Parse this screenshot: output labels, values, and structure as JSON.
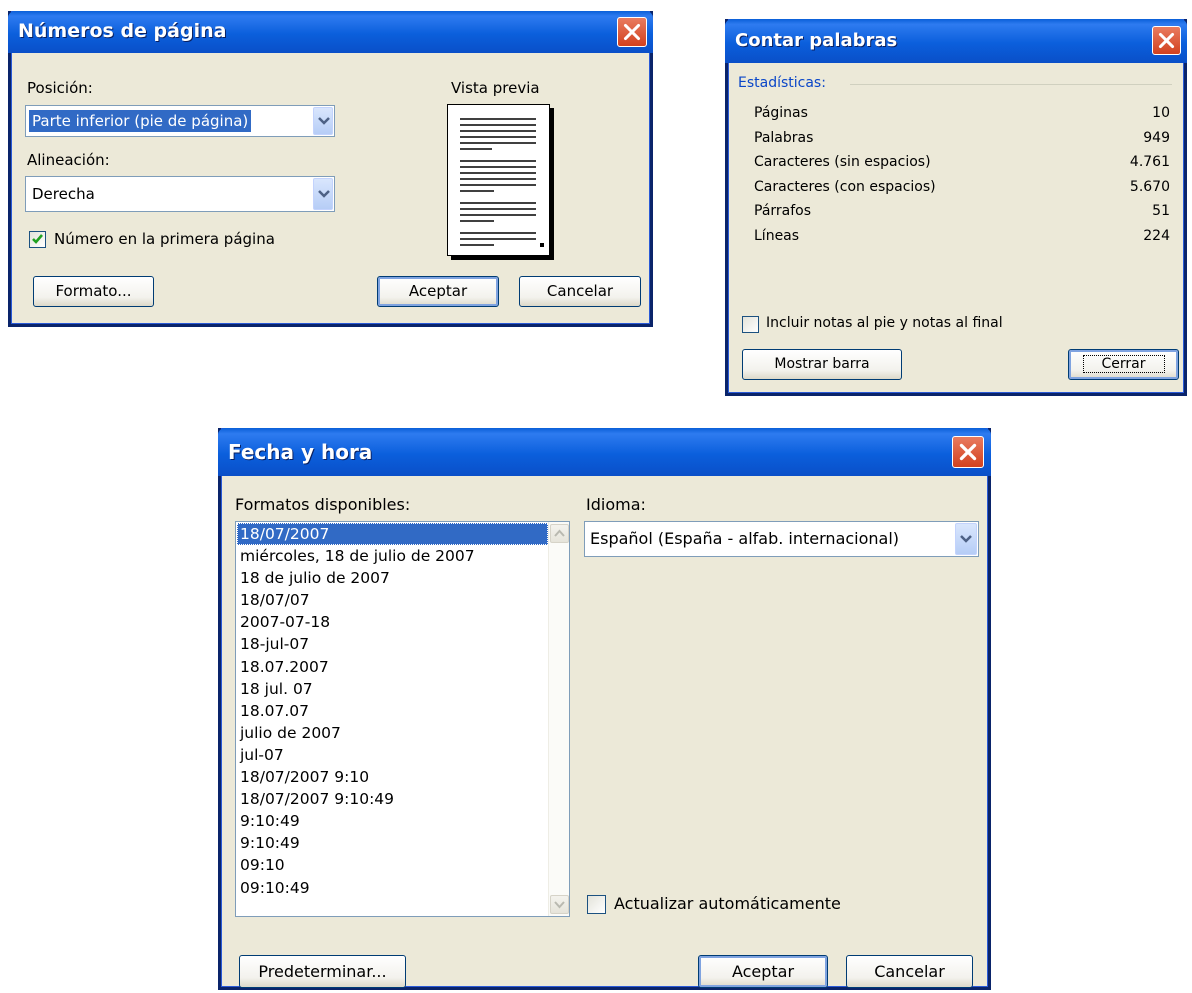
{
  "page_numbers": {
    "title": "Números de página",
    "position_label": "Posición:",
    "position_value": "Parte inferior (pie de página)",
    "alignment_label": "Alineación:",
    "alignment_value": "Derecha",
    "first_page_label": "Número en la primera página",
    "first_page_checked": true,
    "preview_label": "Vista previa",
    "format_button": "Formato...",
    "ok_button": "Aceptar",
    "cancel_button": "Cancelar"
  },
  "word_count": {
    "title": "Contar palabras",
    "section_label": "Estadísticas:",
    "stats": [
      {
        "label": "Páginas",
        "value": "10"
      },
      {
        "label": "Palabras",
        "value": "949"
      },
      {
        "label": "Caracteres (sin espacios)",
        "value": "4.761"
      },
      {
        "label": "Caracteres (con espacios)",
        "value": "5.670"
      },
      {
        "label": "Párrafos",
        "value": "51"
      },
      {
        "label": "Líneas",
        "value": "224"
      }
    ],
    "include_notes_label": "Incluir notas al pie y notas al final",
    "include_notes_checked": false,
    "show_toolbar_button": "Mostrar barra",
    "close_button": "Cerrar"
  },
  "date_time": {
    "title": "Fecha y hora",
    "formats_label": "Formatos disponibles:",
    "formats": [
      "18/07/2007",
      "miércoles, 18 de julio de 2007",
      "18 de julio de 2007",
      "18/07/07",
      "2007-07-18",
      "18-jul-07",
      "18.07.2007",
      "18 jul. 07",
      "18.07.07",
      "julio de 2007",
      "jul-07",
      "18/07/2007 9:10",
      "18/07/2007 9:10:49",
      "9:10:49",
      "9:10:49",
      "09:10",
      "09:10:49"
    ],
    "selected_index": 0,
    "language_label": "Idioma:",
    "language_value": "Español (España - alfab. internacional)",
    "auto_update_label": "Actualizar automáticamente",
    "auto_update_checked": false,
    "default_button": "Predeterminar...",
    "ok_button": "Aceptar",
    "cancel_button": "Cancelar"
  },
  "colors": {
    "title_blue": "#0b5fdc",
    "dialog_face": "#ece9d8",
    "close_red": "#d2411f",
    "selection_blue": "#316ac5",
    "section_label_blue": "#0a46c8"
  }
}
